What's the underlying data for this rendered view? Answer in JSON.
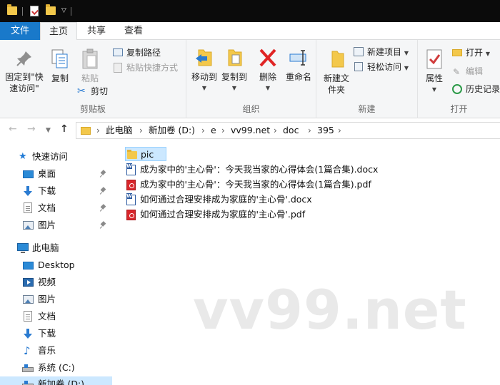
{
  "tabs": {
    "file": "文件",
    "home": "主页",
    "share": "共享",
    "view": "查看"
  },
  "ribbon": {
    "clipboard": {
      "label": "剪贴板",
      "pin_quick": "固定到\"快速访问\"",
      "copy": "复制",
      "paste": "粘贴",
      "copy_path": "复制路径",
      "paste_shortcut": "粘贴快捷方式",
      "cut": "剪切"
    },
    "organize": {
      "label": "组织",
      "move_to": "移动到",
      "copy_to": "复制到",
      "delete": "删除",
      "rename": "重命名"
    },
    "new": {
      "label": "新建",
      "new_folder": "新建文件夹",
      "new_item": "新建项目",
      "easy_access": "轻松访问"
    },
    "open": {
      "label": "打开",
      "properties": "属性",
      "open": "打开",
      "edit": "编辑",
      "history": "历史记录"
    }
  },
  "address": {
    "crumbs": [
      "此电脑",
      "新加卷 (D:)",
      "e",
      "vv99.net",
      "doc",
      "395"
    ]
  },
  "nav": {
    "quick_access": "快速访问",
    "quick_items": [
      "桌面",
      "下载",
      "文档",
      "图片"
    ],
    "this_pc": "此电脑",
    "pc_items": [
      "Desktop",
      "视频",
      "图片",
      "文档",
      "下载",
      "音乐",
      "系统 (C:)",
      "新加卷 (D:)"
    ]
  },
  "files": [
    {
      "name": "pic",
      "type": "folder"
    },
    {
      "name": "成为家中的'主心骨'：今天我当家的心得体会(1篇合集).docx",
      "type": "docx"
    },
    {
      "name": "成为家中的'主心骨'：今天我当家的心得体会(1篇合集).pdf",
      "type": "pdf"
    },
    {
      "name": "如何通过合理安排成为家庭的'主心骨'.docx",
      "type": "docx"
    },
    {
      "name": "如何通过合理安排成为家庭的'主心骨'.pdf",
      "type": "pdf"
    }
  ],
  "watermark": "vv99.net",
  "colors": {
    "file_tab": "#1979ca",
    "selection": "#cce8ff",
    "folder": "#f3c84b",
    "delete_x": "#e02424"
  }
}
